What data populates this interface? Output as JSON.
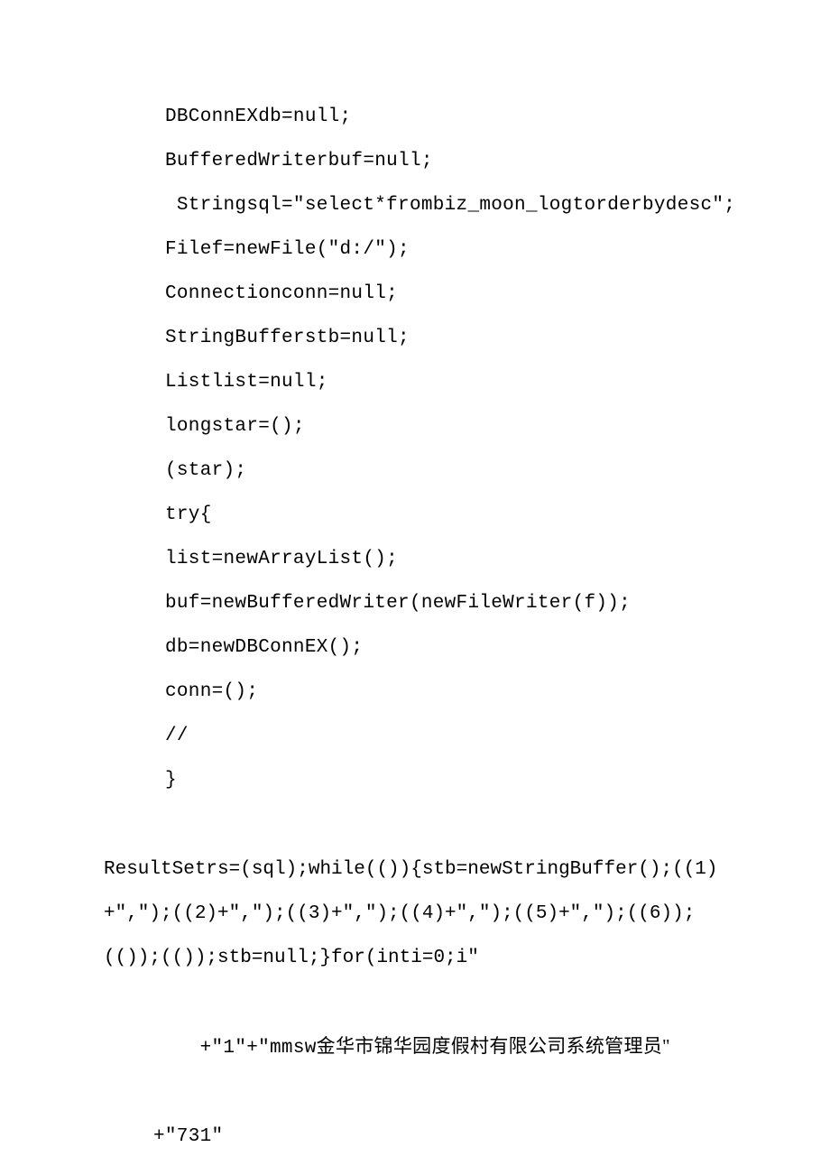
{
  "code": {
    "l1": "DBConnEXdb=null;",
    "l2": "BufferedWriterbuf=null;",
    "l3": " Stringsql=\"select*frombiz_moon_logtorderbydesc\";",
    "l4": "Filef=newFile(\"d:/\");",
    "l5": "Connectionconn=null;",
    "l6": "StringBufferstb=null;",
    "l7": "Listlist=null;",
    "l8": "longstar=();",
    "l9": "(star);",
    "l10": "try{",
    "l11": "list=newArrayList();",
    "l12": "buf=newBufferedWriter(newFileWriter(f));",
    "l13": "db=newDBConnEX();",
    "l14": "conn=();",
    "l15": "//",
    "l16": "}"
  },
  "block2": {
    "flow": "ResultSetrs=(sql);while(()){stb=newStringBuffer();((1)+\",\");((2)+\",\");((3)+\",\");((4)+\",\");((5)+\",\");((6));(());(());stb=null;}for(inti=0;i\"",
    "l17a": "+\"1\"+\"mmsw",
    "l17b": "金华市锦华园度假村有限公司系统管理员\"",
    "l18": "+\"731\""
  }
}
